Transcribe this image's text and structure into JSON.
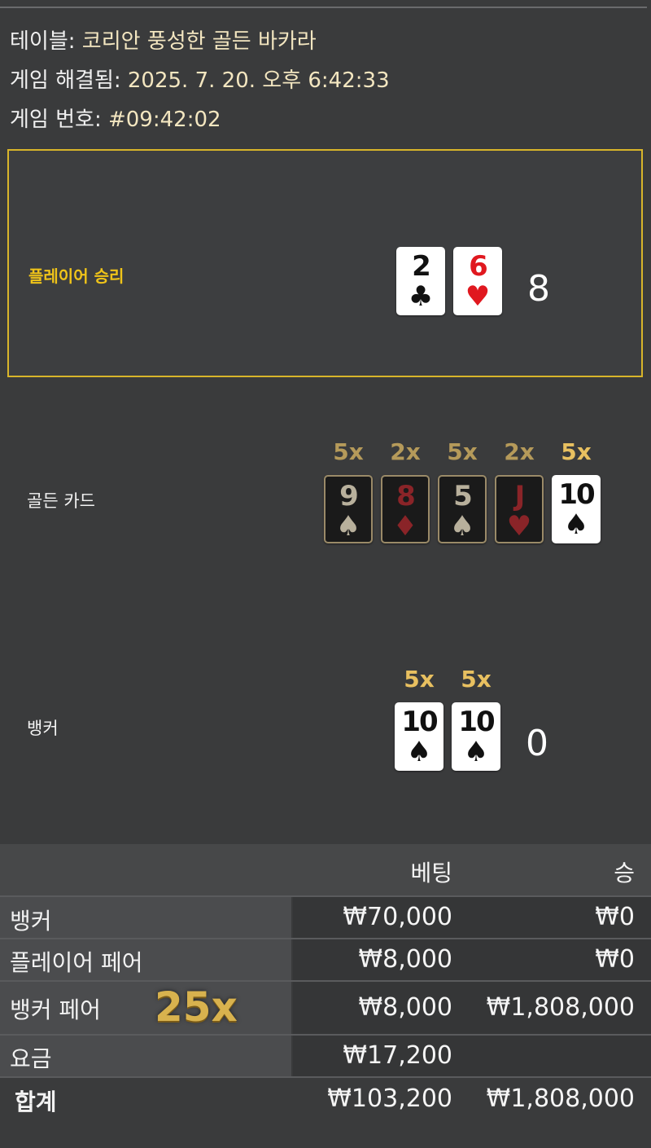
{
  "info": {
    "table_label": "테이블:",
    "table_value": "코리안 풍성한 골든 바카라",
    "resolved_label": "게임 해결됨:",
    "resolved_value": "2025. 7. 20. 오후 6:42:33",
    "game_no_label": "게임 번호:",
    "game_no_value": "#09:42:02"
  },
  "player": {
    "label": "플레이어 승리",
    "cards": [
      {
        "rank": "2",
        "suit": "♣",
        "color": "black"
      },
      {
        "rank": "6",
        "suit": "♥",
        "color": "red"
      }
    ],
    "score": "8"
  },
  "golden": {
    "label": "골든 카드",
    "cards": [
      {
        "rank": "9",
        "suit": "♠",
        "mult": "5x"
      },
      {
        "rank": "8",
        "suit": "♦",
        "mult": "2x"
      },
      {
        "rank": "5",
        "suit": "♠",
        "mult": "5x"
      },
      {
        "rank": "J",
        "suit": "♥",
        "mult": "2x"
      },
      {
        "rank": "10",
        "suit": "♠",
        "mult": "5x"
      }
    ]
  },
  "banker": {
    "label": "뱅커",
    "cards": [
      {
        "rank": "10",
        "suit": "♠",
        "mult": "5x"
      },
      {
        "rank": "10",
        "suit": "♠",
        "mult": "5x"
      }
    ],
    "score": "0"
  },
  "bets": {
    "header_bet": "베팅",
    "header_win": "승",
    "rows": [
      {
        "label": "뱅커",
        "bet": "₩70,000",
        "win": "₩0"
      },
      {
        "label": "플레이어 페어",
        "bet": "₩8,000",
        "win": "₩0"
      },
      {
        "label": "뱅커 페어",
        "bet": "₩8,000",
        "win": "₩1,808,000",
        "badge": "25x"
      },
      {
        "label": "요금",
        "bet": "₩17,200",
        "win": ""
      }
    ],
    "total": {
      "label": "합계",
      "bet": "₩103,200",
      "win": "₩1,808,000"
    }
  },
  "colors": {
    "accent": "#d8b52a",
    "winner_label": "#f0c419",
    "multiplier": "#b59a5a",
    "red_suit": "#e0181f"
  }
}
